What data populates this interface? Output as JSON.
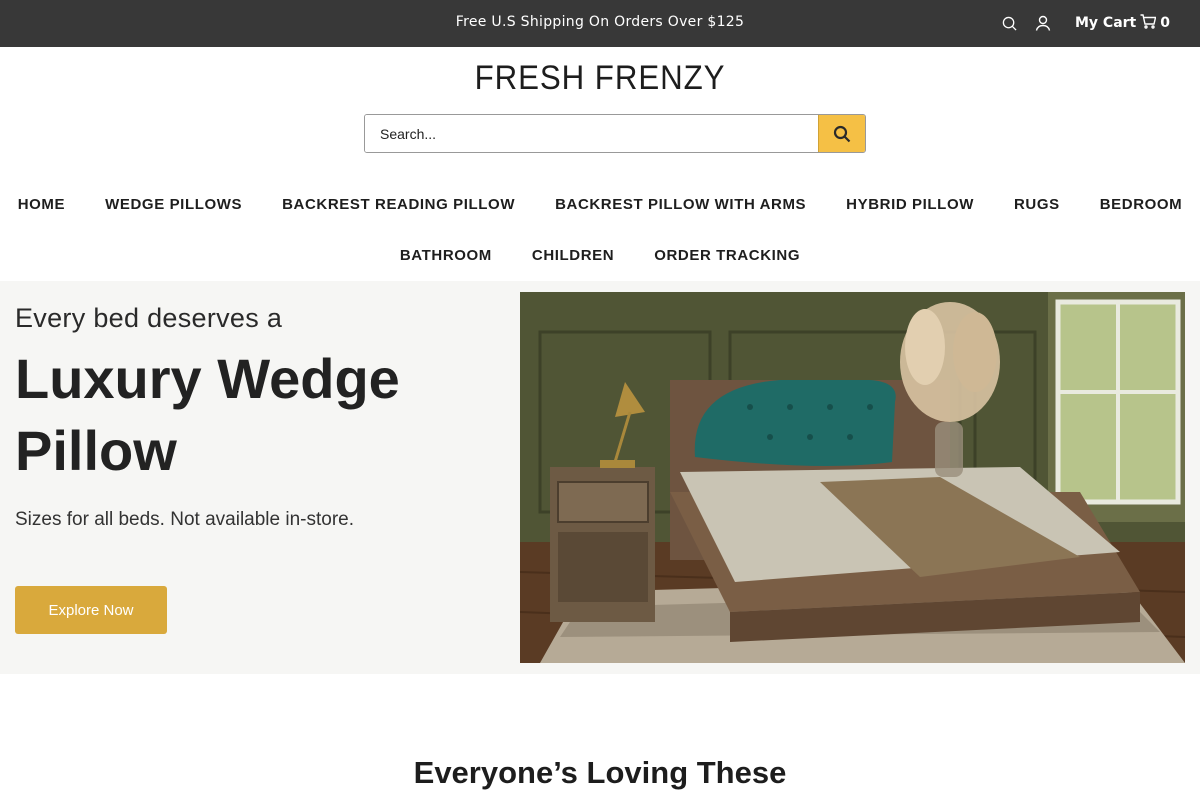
{
  "topbar": {
    "announcement": "Free U.S Shipping On Orders Over $125",
    "cart_label": "My Cart",
    "cart_count": "0",
    "icons": [
      "search-icon",
      "account-icon",
      "cart-icon"
    ]
  },
  "header": {
    "logo": "FRESH FRENZY",
    "search_placeholder": "Search..."
  },
  "nav": {
    "row1": [
      "HOME",
      "WEDGE PILLOWS",
      "BACKREST READING PILLOW",
      "BACKREST PILLOW WITH ARMS",
      "HYBRID PILLOW",
      "RUGS",
      "BEDROOM"
    ],
    "row2": [
      "BATHROOM",
      "CHILDREN",
      "ORDER TRACKING"
    ]
  },
  "hero": {
    "pre_title": "Every bed deserves a",
    "title": "Luxury Wedge Pillow",
    "subtitle": "Sizes for all beds. Not available in-store.",
    "cta": "Explore Now"
  },
  "section": {
    "title": "Everyone’s Loving These"
  },
  "colors": {
    "topbar_bg": "#383838",
    "accent": "#d9a93c",
    "search_button": "#f5c045",
    "hero_bg": "#f6f6f4"
  }
}
